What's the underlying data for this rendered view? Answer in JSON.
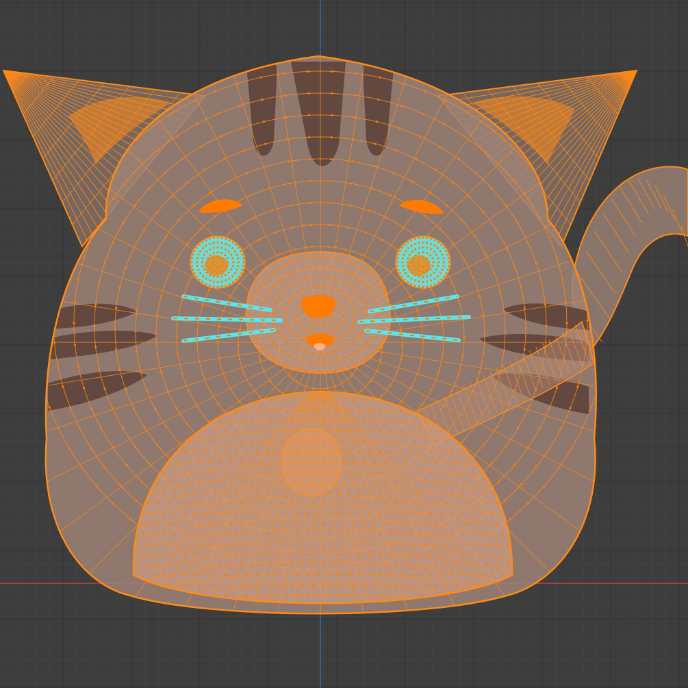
{
  "viewport": {
    "view": "front-orthographic",
    "mode": "edit-mode-wireframe-xray",
    "colors": {
      "background": "#3d3d3d",
      "grid_major": "#353535",
      "grid_minor": "#444444",
      "axis_x": "#c0424a",
      "axis_z": "#3f68b4",
      "wire": "#ff8a17",
      "vertex": "#ff7a00",
      "body_fill": "#9e8377",
      "stripe": "#5a4036",
      "belly_fill": "#c59a82",
      "eye_fill": "#6fd9d4",
      "whisker": "#59e6ef"
    }
  },
  "scene": {
    "object": "cat-plush-mesh",
    "selection": "all-selected"
  }
}
